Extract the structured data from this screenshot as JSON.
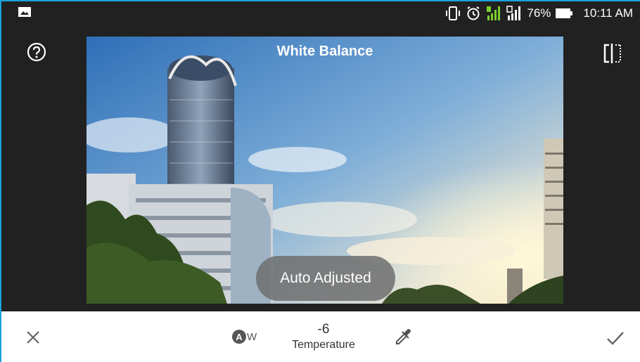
{
  "status_bar": {
    "battery_percent": "76%",
    "time": "10:11 AM",
    "icons": [
      "gallery-icon",
      "vibrate-icon",
      "alarm-icon",
      "signal-sim1-icon",
      "signal-sim2-icon",
      "battery-icon"
    ]
  },
  "editor": {
    "title": "White Balance",
    "toast": "Auto Adjusted",
    "help_icon": "help-circle-icon",
    "compare_icon": "compare-icon"
  },
  "toolbar": {
    "cancel_icon": "close-icon",
    "apply_icon": "check-icon",
    "auto_letter": "A",
    "auto_suffix": "W",
    "value": "-6",
    "label": "Temperature",
    "eyedropper_icon": "eyedropper-icon"
  },
  "colors": {
    "accent_frame": "#1aa3e0",
    "background": "#212121",
    "toolbar": "#ffffff",
    "signal_sim1": "#7ccf2c"
  }
}
